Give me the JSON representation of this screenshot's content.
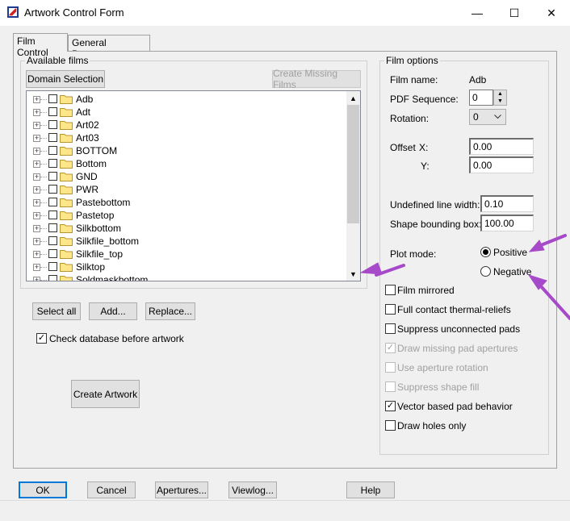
{
  "window": {
    "title": "Artwork Control Form",
    "minimize_glyph": "—",
    "maximize_glyph": "☐",
    "close_glyph": "✕"
  },
  "tabs": [
    {
      "label": "Film Control",
      "active": true
    },
    {
      "label": "General Parameters",
      "active": false
    }
  ],
  "available_films": {
    "group_label": "Available films",
    "domain_selection_label": "Domain Selection",
    "create_missing_label": "Create Missing Films",
    "items": [
      "Adb",
      "Adt",
      "Art02",
      "Art03",
      "BOTTOM",
      "Bottom",
      "GND",
      "PWR",
      "Pastebottom",
      "Pastetop",
      "Silkbottom",
      "Silkfile_bottom",
      "Silkfile_top",
      "Silktop",
      "Soldmaskbottom"
    ],
    "select_all_label": "Select all",
    "add_label": "Add...",
    "replace_label": "Replace...",
    "check_db_label": "Check database before artwork",
    "check_db_checked": true,
    "create_artwork_label": "Create Artwork"
  },
  "film_options": {
    "group_label": "Film options",
    "film_name_label": "Film name:",
    "film_name_value": "Adb",
    "pdf_sequence_label": "PDF Sequence:",
    "pdf_sequence_value": "0",
    "rotation_label": "Rotation:",
    "rotation_value": "0",
    "offset_label": "Offset",
    "offset_x_label": "X:",
    "offset_x_value": "0.00",
    "offset_y_label": "Y:",
    "offset_y_value": "0.00",
    "undefined_line_width_label": "Undefined line width:",
    "undefined_line_width_value": "0.10",
    "shape_bounding_box_label": "Shape bounding box:",
    "shape_bounding_box_value": "100.00",
    "plot_mode_label": "Plot mode:",
    "plot_mode_positive": "Positive",
    "plot_mode_negative": "Negative",
    "plot_mode_selected": "Positive",
    "options": [
      {
        "label": "Film mirrored",
        "checked": false,
        "enabled": true
      },
      {
        "label": "Full contact thermal-reliefs",
        "checked": false,
        "enabled": true
      },
      {
        "label": "Suppress unconnected pads",
        "checked": false,
        "enabled": true
      },
      {
        "label": "Draw missing pad apertures",
        "checked": true,
        "enabled": false
      },
      {
        "label": "Use aperture rotation",
        "checked": false,
        "enabled": false
      },
      {
        "label": "Suppress shape fill",
        "checked": false,
        "enabled": false
      },
      {
        "label": "Vector based pad behavior",
        "checked": true,
        "enabled": true
      },
      {
        "label": "Draw holes only",
        "checked": false,
        "enabled": true
      }
    ]
  },
  "footer": {
    "ok_label": "OK",
    "cancel_label": "Cancel",
    "apertures_label": "Apertures...",
    "viewlog_label": "Viewlog...",
    "help_label": "Help"
  },
  "colors": {
    "annotation_arrow": "#a64ac9",
    "accent": "#0078d7"
  }
}
